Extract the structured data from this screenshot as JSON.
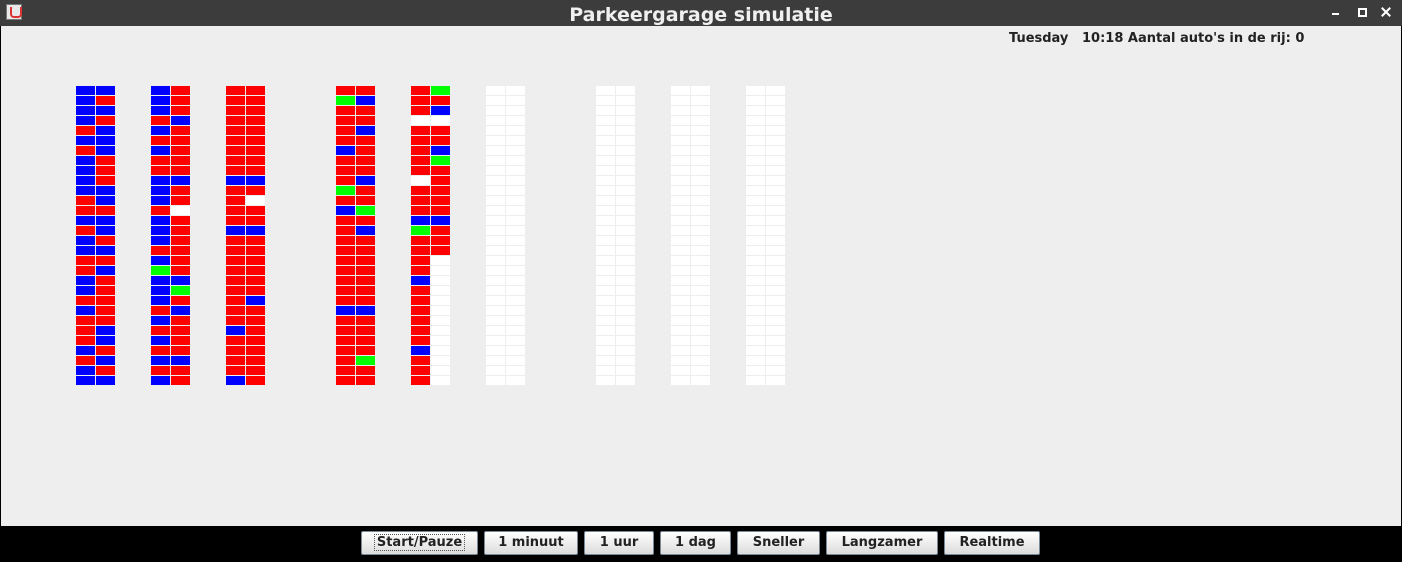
{
  "window": {
    "title": "Parkeergarage simulatie"
  },
  "status": {
    "day": "Tuesday",
    "time": "10:18",
    "queue_label": "Aantal auto's in de rij:",
    "queue_count": "0"
  },
  "colors": {
    "background": "#eeeeee",
    "empty": "#ffffff",
    "regular": "#ff0000",
    "subscriber": "#0000ff",
    "reserved": "#00ff00",
    "titlebar": "#3c3c3c"
  },
  "legend_codes": {
    "R": "regular",
    "B": "subscriber",
    "G": "reserved",
    "E": "empty"
  },
  "garage": {
    "floors": [
      {
        "rows": [
          "BBBBRBRBBBBRRBRBBRRBBRBRRRBRBB",
          "BRBRBBBRRRBBRBBRBRBRRRRRBBRBRB"
        ]
      },
      {
        "rows": [
          "BBBRBRBRRBBBRBBBRBGBBBRBRBRBRB",
          "RRRBRRRRRBRRERRRRRRBGRBRRRRBRR"
        ]
      },
      {
        "rows": [
          "RRRRRRRRRBRRRRBRRRRRRRRRBRRRRB",
          "RRRRRRRRRBRERRBRRRRRRBRRRRRRRR"
        ]
      },
      {
        "rows": [
          "RGRRRRBRRRGRBRRRRRRRRRBRRRRRRR",
          "RBRRBRRRRBRRGRBRRRRRRRBRRRRGRR"
        ]
      },
      {
        "rows": [
          "RRRERRRRRERRRBGRRRRBRRRRRRBRRR",
          "GRBERRBGRRRRRBRRREEEEEEEEEEEEE"
        ]
      },
      {
        "rows": [
          "EEEEEEEEEEEEEEEEEEEEEEEEEEEEEE",
          "EEEEEEEEEEEEEEEEEEEEEEEEEEEEEE"
        ]
      },
      {
        "rows": [
          "EEEEEEEEEEEEEEEEEEEEEEEEEEEEEE",
          "EEEEEEEEEEEEEEEEEEEEEEEEEEEEEE"
        ]
      },
      {
        "rows": [
          "EEEEEEEEEEEEEEEEEEEEEEEEEEEEEE",
          "EEEEEEEEEEEEEEEEEEEEEEEEEEEEEE"
        ]
      },
      {
        "rows": [
          "EEEEEEEEEEEEEEEEEEEEEEEEEEEEEE",
          "EEEEEEEEEEEEEEEEEEEEEEEEEEEEEE"
        ]
      }
    ]
  },
  "controls": {
    "start_pauze": "Start/Pauze",
    "one_minute": "1 minuut",
    "one_hour": "1 uur",
    "one_day": "1 dag",
    "faster": "Sneller",
    "slower": "Langzamer",
    "realtime": "Realtime"
  }
}
